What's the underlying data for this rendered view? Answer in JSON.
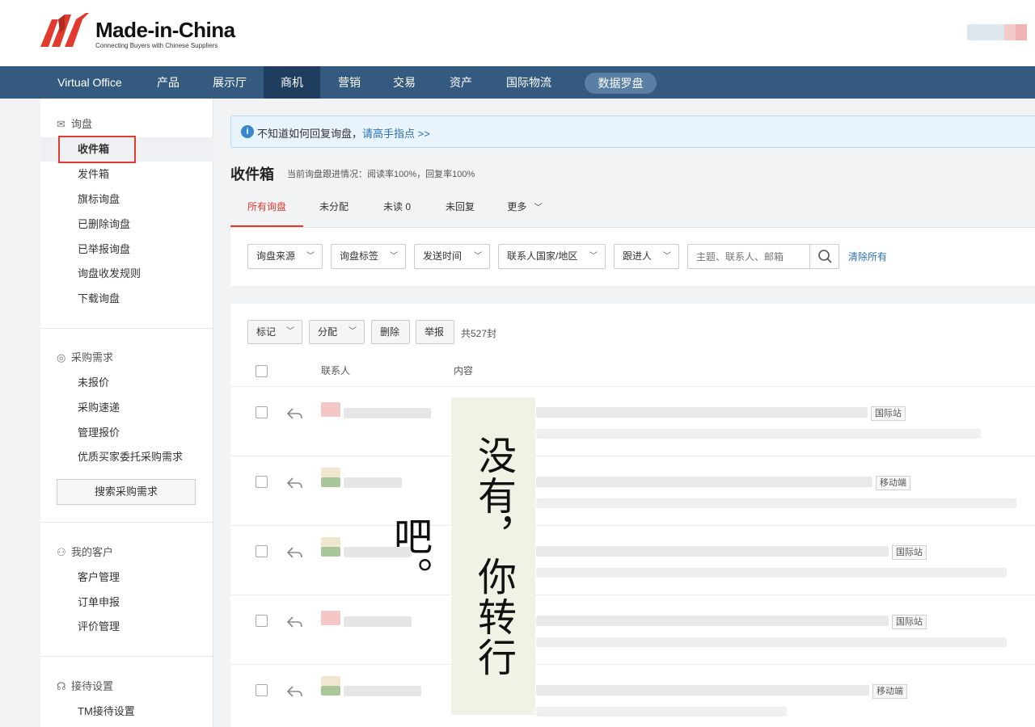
{
  "brand": {
    "name": "Made-in-China",
    "tagline": "Connecting Buyers with Chinese Suppliers",
    "colors": {
      "nav": "#355a80",
      "accent": "#e23a2f",
      "link": "#2a6fb8"
    }
  },
  "nav": {
    "items": [
      "Virtual Office",
      "产品",
      "展示厅",
      "商机",
      "营销",
      "交易",
      "资产",
      "国际物流"
    ],
    "active_index": 3,
    "pill": "数据罗盘"
  },
  "sidebar": {
    "inquiry": {
      "title": "询盘",
      "items": [
        "收件箱",
        "发件箱",
        "旗标询盘",
        "已删除询盘",
        "已举报询盘",
        "询盘收发规则",
        "下载询盘"
      ]
    },
    "purchase": {
      "title": "采购需求",
      "items": [
        "未报价",
        "采购速递",
        "管理报价",
        "优质买家委托采购需求"
      ],
      "button": "搜索采购需求"
    },
    "customers": {
      "title": "我的客户",
      "items": [
        "客户管理",
        "订单申报",
        "评价管理"
      ]
    },
    "reception": {
      "title": "接待设置",
      "items": [
        "TM接待设置"
      ]
    }
  },
  "notice": {
    "text": "不知道如何回复询盘，",
    "link": "请高手指点 >>"
  },
  "page": {
    "title": "收件箱",
    "stat": "当前询盘跟进情况：阅读率100%，回复率100%"
  },
  "tabs": {
    "items": [
      "所有询盘",
      "未分配",
      "未读 0",
      "未回复",
      "更多"
    ],
    "active_index": 0
  },
  "filters": {
    "selects": [
      "询盘来源",
      "询盘标签",
      "发送时间",
      "联系人国家/地区",
      "跟进人"
    ],
    "search_placeholder": "主题、联系人、邮箱",
    "clear": "清除所有"
  },
  "list": {
    "actions": {
      "mark": "标记",
      "assign": "分配",
      "delete": "删除",
      "report": "举报"
    },
    "count": "共527封",
    "columns": {
      "contact": "联系人",
      "content": "内容"
    },
    "rows": [
      {
        "tag": "国际站"
      },
      {
        "tag": "移动端"
      },
      {
        "tag": "国际站"
      },
      {
        "tag": "国际站"
      },
      {
        "tag": "移动端"
      }
    ]
  },
  "overlay": {
    "text": "没有，你转行吧。"
  },
  "icons": [
    "mail-icon",
    "search-icon",
    "reply-icon",
    "info-icon",
    "chevron-down-icon",
    "user-group-icon",
    "headset-icon",
    "purchase-icon"
  ]
}
